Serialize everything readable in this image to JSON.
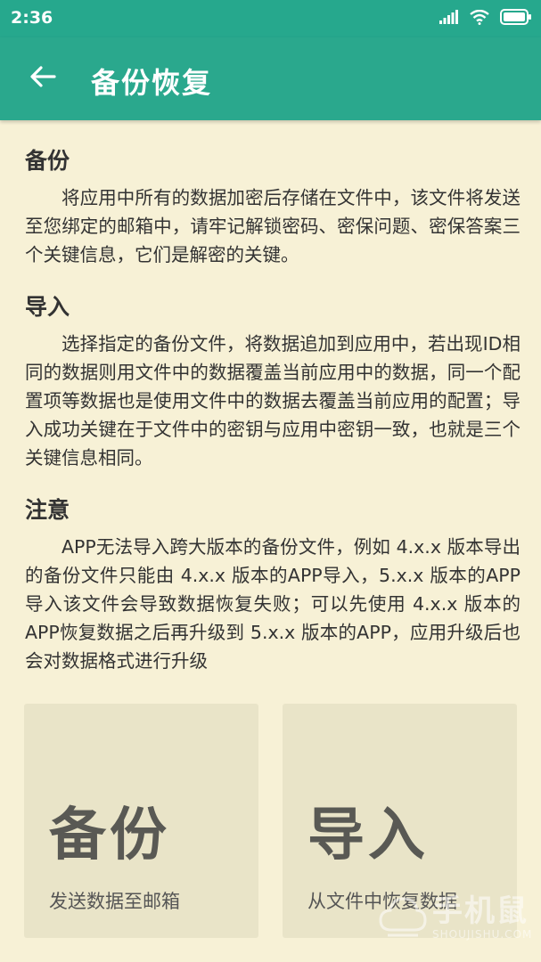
{
  "status_bar": {
    "time": "2:36",
    "icons": [
      "signal-icon",
      "wifi-icon",
      "battery-icon"
    ]
  },
  "app_bar": {
    "title": "备份恢复",
    "back_icon": "arrow-left-icon",
    "background": "#2aa88d"
  },
  "sections": [
    {
      "heading": "备份",
      "body": "将应用中所有的数据加密后存储在文件中，该文件将发送至您绑定的邮箱中，请牢记解锁密码、密保问题、密保答案三个关键信息，它们是解密的关键。"
    },
    {
      "heading": "导入",
      "body": "选择指定的备份文件，将数据追加到应用中，若出现ID相同的数据则用文件中的数据覆盖当前应用中的数据，同一个配置项等数据也是使用文件中的数据去覆盖当前应用的配置；导入成功关键在于文件中的密钥与应用中密钥一致，也就是三个关键信息相同。"
    },
    {
      "heading": "注意",
      "body": "APP无法导入跨大版本的备份文件，例如 4.x.x 版本导出的备份文件只能由 4.x.x 版本的APP导入，5.x.x 版本的APP导入该文件会导致数据恢复失败；可以先使用 4.x.x 版本的APP恢复数据之后再升级到 5.x.x 版本的APP，应用升级后也会对数据格式进行升级"
    }
  ],
  "actions": {
    "backup": {
      "title": "备份",
      "subtitle": "发送数据至邮箱"
    },
    "import": {
      "title": "导入",
      "subtitle": "从文件中恢复数据"
    }
  },
  "watermark": {
    "text": "手机鼠",
    "sub": "SHOUJISHU.COM"
  },
  "colors": {
    "page_background": "#f7f1d6",
    "card_background": "#e9e4c8",
    "accent": "#2aa88d"
  }
}
